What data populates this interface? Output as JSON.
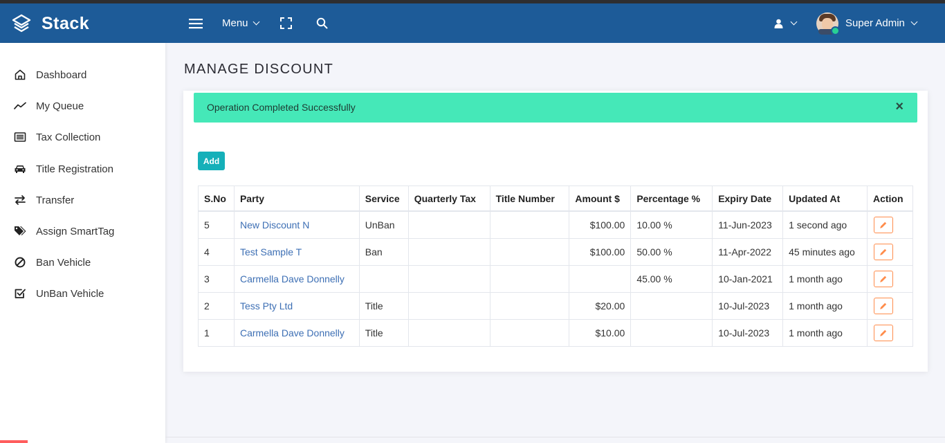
{
  "app": {
    "brand": "Stack"
  },
  "navbar": {
    "menu_label": "Menu",
    "user_name": "Super Admin"
  },
  "sidebar": {
    "items": [
      {
        "label": "Dashboard",
        "icon": "home-icon"
      },
      {
        "label": "My Queue",
        "icon": "trend-icon"
      },
      {
        "label": "Tax Collection",
        "icon": "list-icon"
      },
      {
        "label": "Title Registration",
        "icon": "car-icon"
      },
      {
        "label": "Transfer",
        "icon": "exchange-icon"
      },
      {
        "label": "Assign SmartTag",
        "icon": "tags-icon"
      },
      {
        "label": "Ban Vehicle",
        "icon": "ban-icon"
      },
      {
        "label": "UnBan Vehicle",
        "icon": "check-square-icon"
      }
    ]
  },
  "page": {
    "title": "MANAGE DISCOUNT"
  },
  "alert": {
    "message": "Operation Completed Successfully",
    "close": "×"
  },
  "toolbar": {
    "add_label": "Add"
  },
  "table": {
    "headers": [
      "S.No",
      "Party",
      "Service",
      "Quarterly Tax",
      "Title Number",
      "Amount $",
      "Percentage %",
      "Expiry Date",
      "Updated At",
      "Action"
    ],
    "rows": [
      {
        "sno": "5",
        "party": "New Discount N",
        "service": "UnBan",
        "quarterly_tax": "",
        "title_number": "",
        "amount": "$100.00",
        "percentage": "10.00 %",
        "expiry": "11-Jun-2023",
        "updated": "1 second ago"
      },
      {
        "sno": "4",
        "party": "Test Sample T",
        "service": "Ban",
        "quarterly_tax": "",
        "title_number": "",
        "amount": "$100.00",
        "percentage": "50.00 %",
        "expiry": "11-Apr-2022",
        "updated": "45 minutes ago"
      },
      {
        "sno": "3",
        "party": "Carmella Dave Donnelly",
        "service": "",
        "quarterly_tax": "",
        "title_number": "",
        "amount": "",
        "percentage": "45.00 %",
        "expiry": "10-Jan-2021",
        "updated": "1 month ago"
      },
      {
        "sno": "2",
        "party": "Tess Pty Ltd",
        "service": "Title",
        "quarterly_tax": "",
        "title_number": "",
        "amount": "$20.00",
        "percentage": "",
        "expiry": "10-Jul-2023",
        "updated": "1 month ago"
      },
      {
        "sno": "1",
        "party": "Carmella Dave Donnelly",
        "service": "Title",
        "quarterly_tax": "",
        "title_number": "",
        "amount": "$10.00",
        "percentage": "",
        "expiry": "10-Jul-2023",
        "updated": "1 month ago"
      }
    ]
  },
  "colors": {
    "navbar": "#1d5b98",
    "alert_success": "#45e8b8",
    "add_button": "#15b0b9",
    "link": "#3d6fb4",
    "edit_border": "#ff8c4b"
  }
}
